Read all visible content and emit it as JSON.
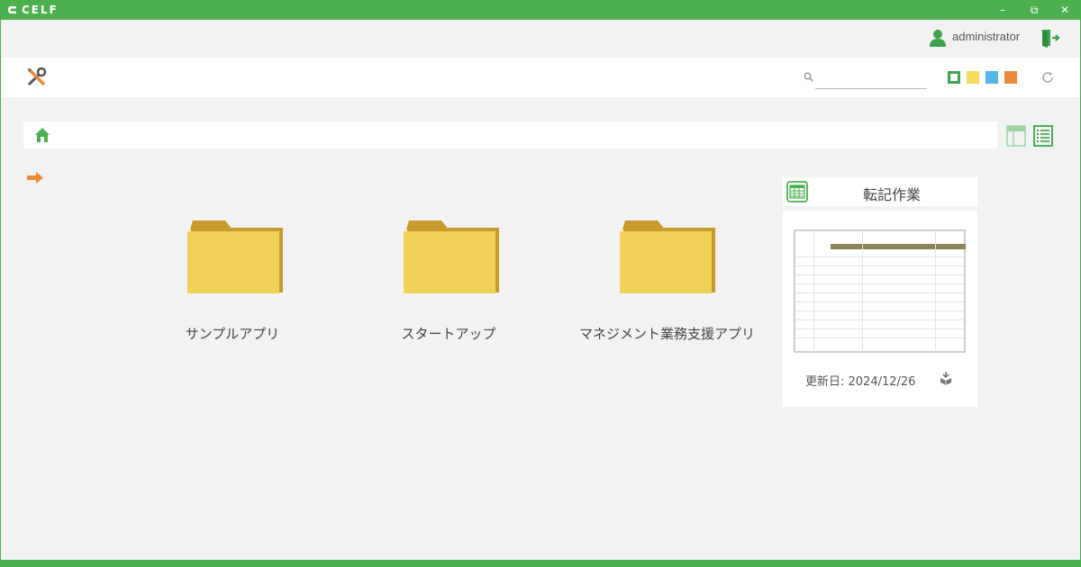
{
  "app": {
    "name": "CELF"
  },
  "window_controls": {
    "minimize": "–",
    "restore": "⧉",
    "close": "✕"
  },
  "user": {
    "name": "administrator"
  },
  "search": {
    "value": "",
    "placeholder": ""
  },
  "theme_colors": [
    "#3fa34d",
    "#f5dc5a",
    "#55b6e8",
    "#e98b3a"
  ],
  "folders": [
    {
      "label": "サンプルアプリ",
      "icon": "folder-icon"
    },
    {
      "label": "スタートアップ",
      "icon": "folder-icon"
    },
    {
      "label": "マネジメント業務支援アプリ",
      "icon": "folder-icon"
    }
  ],
  "card": {
    "title": "転記作業",
    "updated": "更新日: 2024/12/26",
    "icon": "spreadsheet-icon"
  },
  "colors": {
    "accent": "#4caf50",
    "folder": "#f0d257",
    "folder_dark": "#c99a2e"
  }
}
